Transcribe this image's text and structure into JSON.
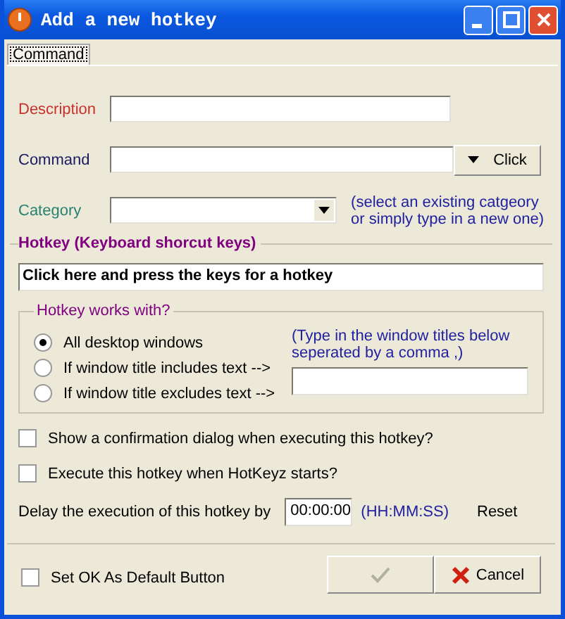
{
  "window": {
    "title": "Add a new hotkey"
  },
  "tabs": [
    {
      "label": "Command",
      "selected": true
    }
  ],
  "fields": [
    {
      "label": "Description",
      "color": "#c8302c",
      "kind": "text"
    },
    {
      "label": "Command",
      "color": "#1a1a60",
      "kind": "button",
      "button": "Click"
    },
    {
      "label": "Category",
      "color": "#2a8070",
      "kind": "combo",
      "hint": "(select an existing catgeory\nor simply type in a new one)"
    }
  ],
  "hotkey": {
    "title": "Hotkey (Keyboard shorcut keys)",
    "key_field": "Click here and press the keys for a hotkey",
    "works_with": {
      "title": "Hotkey works with?",
      "options": [
        {
          "label": "All desktop windows",
          "selected": true
        },
        {
          "label": "If window title includes text -->",
          "selected": false
        },
        {
          "label": "If window title excludes text -->",
          "selected": false
        }
      ],
      "hint": "(Type in the window titles below\nseperated by a comma ,)"
    },
    "checks": [
      {
        "label": "Show a confirmation dialog when executing this hotkey?",
        "checked": false
      },
      {
        "label": "Execute this hotkey when HotKeyz starts?",
        "checked": false
      }
    ],
    "delay": {
      "label": "Delay the execution of this hotkey by",
      "value": "00:00:00",
      "format": "(HH:MM:SS)",
      "reset": "Reset"
    }
  },
  "footer": {
    "default_check": {
      "label": "Set OK As Default Button",
      "checked": false
    },
    "ok": {
      "disabled": true
    },
    "cancel": "Cancel"
  }
}
